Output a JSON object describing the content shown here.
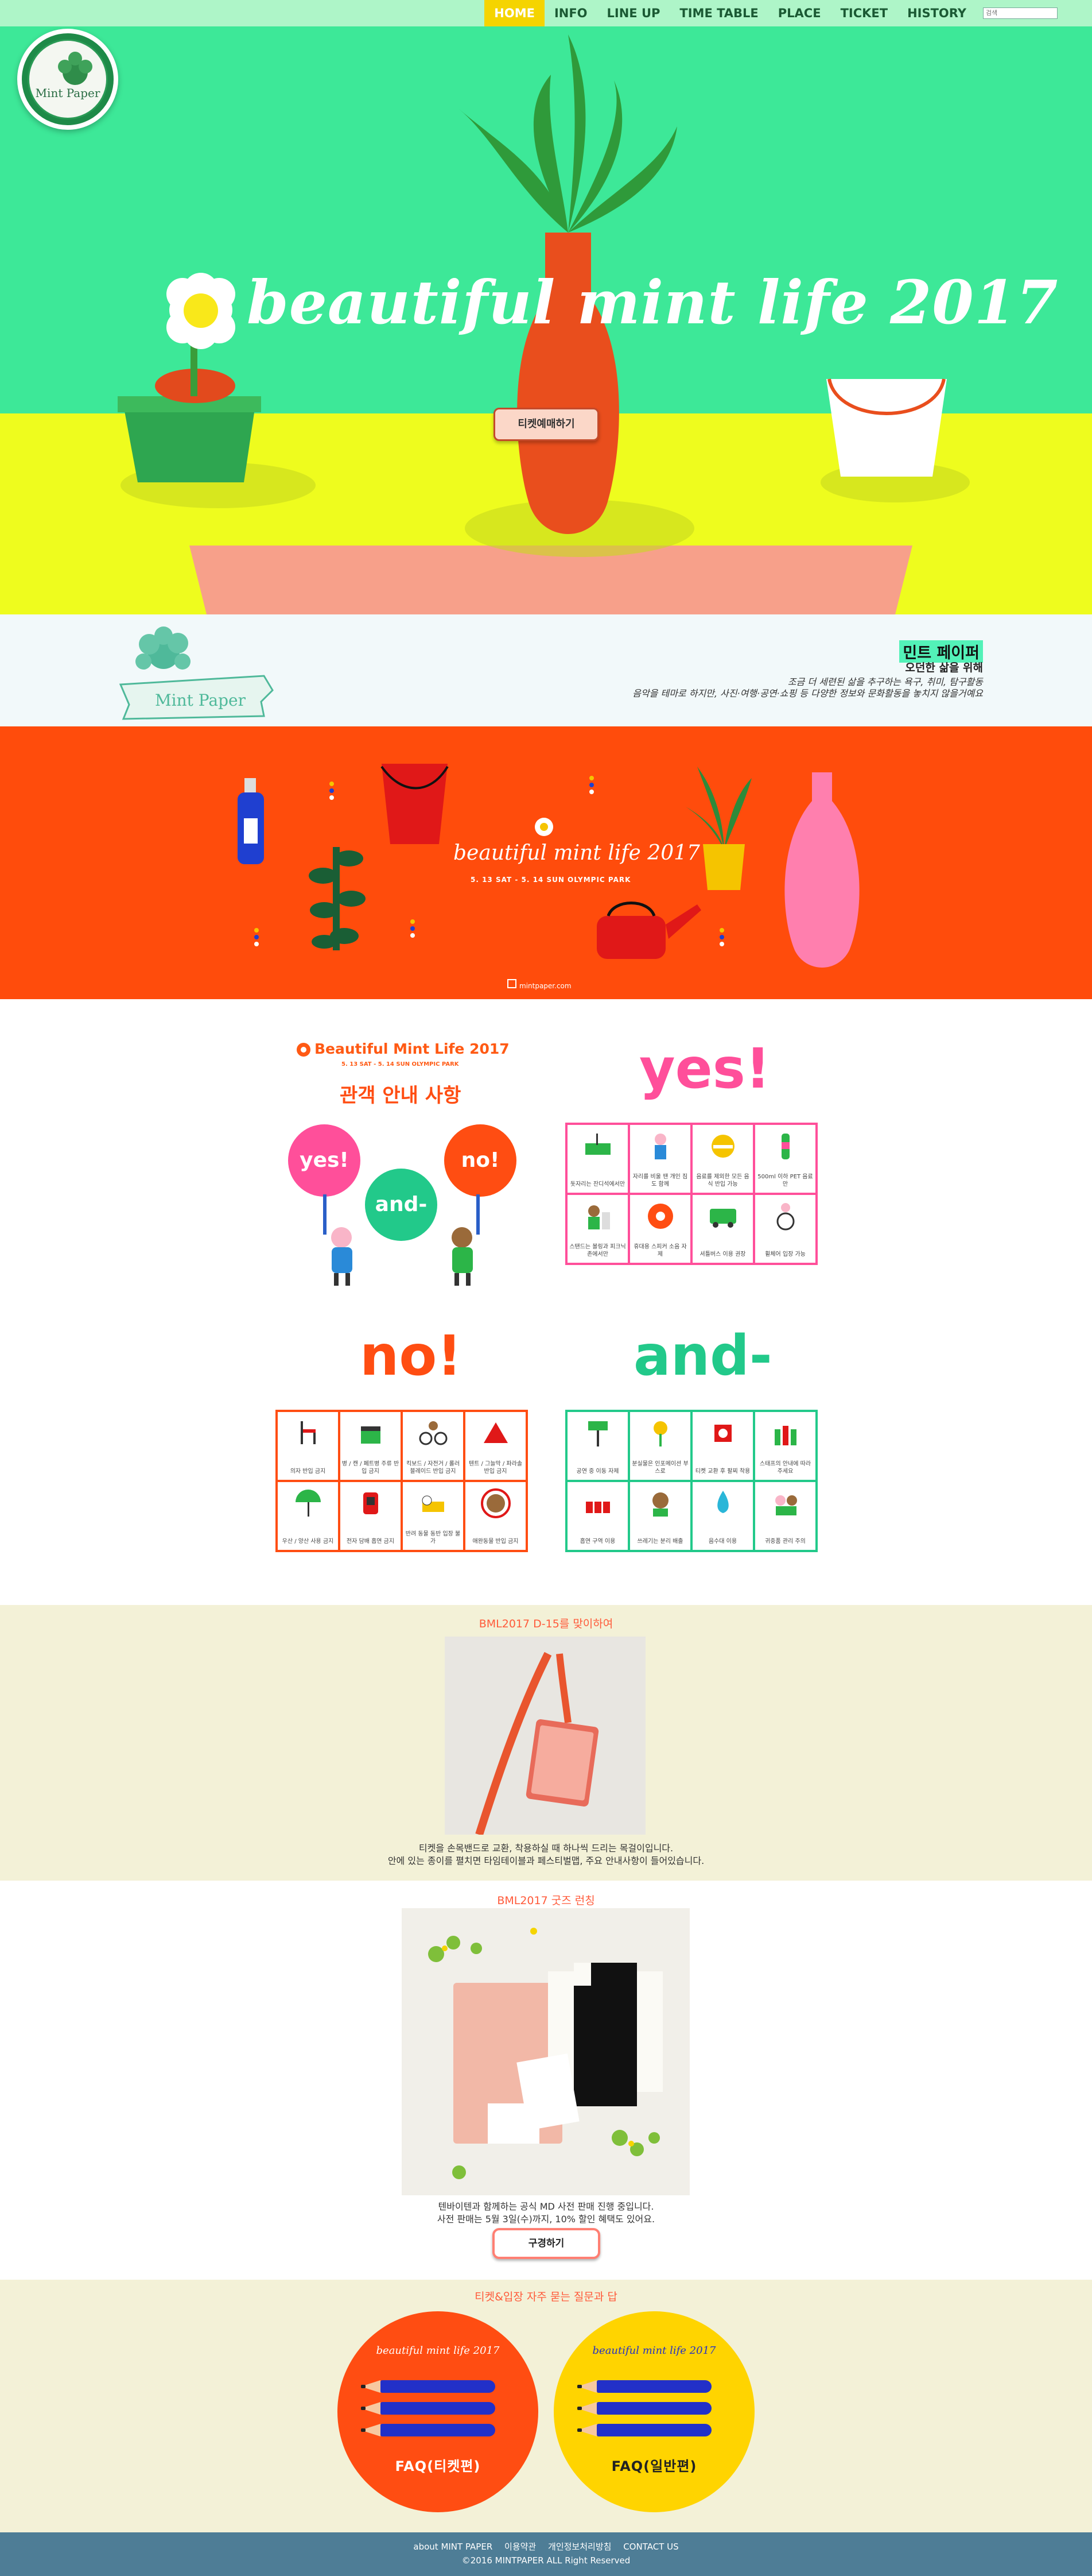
{
  "nav": {
    "items": [
      "HOME",
      "INFO",
      "LINE UP",
      "TIME TABLE",
      "PLACE",
      "TICKET",
      "HISTORY"
    ],
    "search_placeholder": "검색"
  },
  "hero": {
    "logo_text": "Mint Paper",
    "title": "beautiful mint life 2017",
    "ticket_button": "티켓예매하기"
  },
  "about": {
    "logo_text": "Mint Paper",
    "heading": "민트 페이퍼",
    "subheading": "오던한 삶을 위해",
    "line1": "조금 더 세련된 삶을 추구하는 욕구, 취미, 탐구활동",
    "line2": "음악을 테마로 하지만, 사진·여행·공연·쇼핑 등 다양한 정보와 문화활동을 놓치지 않을거예요"
  },
  "banner": {
    "title": "beautiful mint life 2017",
    "date": "5. 13 SAT - 5. 14 SUN OLYMPIC PARK",
    "url": "mintpaper.com"
  },
  "guide": {
    "event_title": "Beautiful Mint Life 2017",
    "event_date": "5. 13 SAT - 5. 14 SUN OLYMPIC PARK",
    "heading": "관객 안내 사항",
    "bubble_yes": "yes!",
    "bubble_and": "and-",
    "bubble_no": "no!",
    "yes_title": "yes!",
    "no_title": "no!",
    "and_title": "and-",
    "yes_items": [
      "돗자리는 잔디석에서만",
      "자리를 비울 땐 개인 짐도 함께",
      "음료를 제외한 모든 음식 반입 가능",
      "500ml 이하 PET 음료만",
      "스탠드는 볼링과 피크닉존에서만",
      "휴대용 스피커 소음 자제",
      "셔틀버스 이용 권장",
      "휠체어 입장 가능"
    ],
    "no_items": [
      "의자 반입 금지",
      "병 / 캔 / 페트병 주류 반입 금지",
      "킥보드 / 자전거 / 롤러블레이드 반입 금지",
      "텐트 / 그늘막 / 파라솔 반입 금지",
      "우산 / 양산 사용 금지",
      "전자 담배 흡연 금지",
      "반려 동물 동반 입장 불가",
      "애완동물 반입 금지"
    ],
    "and_items": [
      "공연 중 이동 자제",
      "분실물은 인포메이션 부스로",
      "티켓 교환 후 팔찌 착용",
      "스태프의 안내에 따라 주세요",
      "흡연 구역 이용",
      "쓰레기는 분리 배출",
      "음수대 이용",
      "귀중품 관리 주의"
    ]
  },
  "gift": {
    "title": "BML2017 D-15를 맞이하여",
    "line1": "티켓을 손목밴드로 교환, 착용하실 때 하나씩 드리는 목걸이입니다.",
    "line2": "안에 있는 종이를 펼치면 타임테이블과 페스티벌맵, 주요 안내사항이 들어있습니다."
  },
  "goods": {
    "title": "BML2017 굿즈 런칭",
    "line1": "텐바이텐과 함께하는 공식 MD 사전 판매 진행 중입니다.",
    "line2": "사전 판매는 5월 3일(수)까지, 10% 할인 혜택도 있어요.",
    "buy_button": "구경하기"
  },
  "faq": {
    "title": "티켓&입장 자주 묻는 질문과 답",
    "card1_label": "FAQ(티켓편)",
    "card2_label": "FAQ(일반편)",
    "card_brand": "beautiful mint life 2017"
  },
  "footer": {
    "links": [
      "about MINT PAPER",
      "이용약관",
      "개인정보처리방침",
      "CONTACT US"
    ],
    "copyright": "©2016 MINTPAPER ALL Right Reserved"
  },
  "colors": {
    "nav_bg": "#aef5c8",
    "nav_active": "#f5d400",
    "hero_mint": "#3de898",
    "hero_yellow": "#eefc1e",
    "banner_orange": "#ff4c0c",
    "yes_pink": "#ff4f9a",
    "no_orange": "#ff4d12",
    "and_green": "#22c98a",
    "footer_bg": "#4e7d96"
  }
}
